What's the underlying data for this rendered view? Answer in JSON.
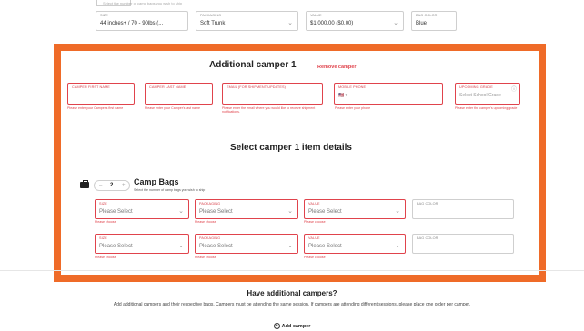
{
  "top_hint": "Select the number of camp bags you wish to ship",
  "top_row": [
    {
      "label": "SIZE",
      "value": "44 inches+ / 70 - 90lbs (...",
      "chevron": "⌄"
    },
    {
      "label": "PACKAGING",
      "value": "Soft Trunk",
      "chevron": "⌄"
    },
    {
      "label": "VALUE",
      "value": "$1,000.00 ($0.00)",
      "chevron": "⌄"
    },
    {
      "label": "BAG COLOR",
      "value": "Blue"
    }
  ],
  "additional_camper": {
    "title": "Additional camper 1",
    "remove_label": "Remove camper",
    "fields": [
      {
        "label": "CAMPER FIRST NAME",
        "value": "",
        "help": "Please enter your Camper's first name"
      },
      {
        "label": "CAMPER LAST NAME",
        "value": "",
        "help": "Please enter your Camper's last name"
      },
      {
        "label": "EMAIL (FOR SHIPMENT UPDATES)",
        "value": "",
        "help": "Please enter the email where you would like to receive shipment notifications."
      },
      {
        "label": "MOBILE PHONE",
        "value": "🇺🇸 ▾",
        "help": "Please enter your phone"
      },
      {
        "label": "UPCOMING GRADE",
        "value": "Select School Grade",
        "info_icon": "ⓘ",
        "help": "Please enter the camper's upcoming grade"
      }
    ]
  },
  "item_details": {
    "title": "Select camper 1 item details",
    "camp_bags": {
      "title": "Camp Bags",
      "subtitle": "Select the number of camp bags you wish to ship",
      "quantity": "2",
      "minus": "–",
      "plus": "+"
    },
    "rows": [
      {
        "size": {
          "label": "SIZE",
          "value": "Please Select",
          "error": "Please choose"
        },
        "packaging": {
          "label": "PACKAGING",
          "value": "Please Select",
          "error": "Please choose"
        },
        "value": {
          "label": "VALUE",
          "value": "Please Select",
          "error": "Please choose"
        },
        "color": {
          "label": "BAG COLOR",
          "value": ""
        }
      },
      {
        "size": {
          "label": "SIZE",
          "value": "Please Select",
          "error": "Please choose"
        },
        "packaging": {
          "label": "PACKAGING",
          "value": "Please Select",
          "error": "Please choose"
        },
        "value": {
          "label": "VALUE",
          "value": "Please Select",
          "error": "Please choose"
        },
        "color": {
          "label": "BAG COLOR",
          "value": ""
        }
      }
    ]
  },
  "footer": {
    "title": "Have additional campers?",
    "description": "Add additional campers and their respective bags. Campers must be attending the same session. If campers are attending different sessions, please place one order per camper.",
    "add_label": "Add camper",
    "add_icon": "+"
  },
  "colors": {
    "accent_orange": "#ef6b28",
    "error_red": "#e0434c"
  }
}
